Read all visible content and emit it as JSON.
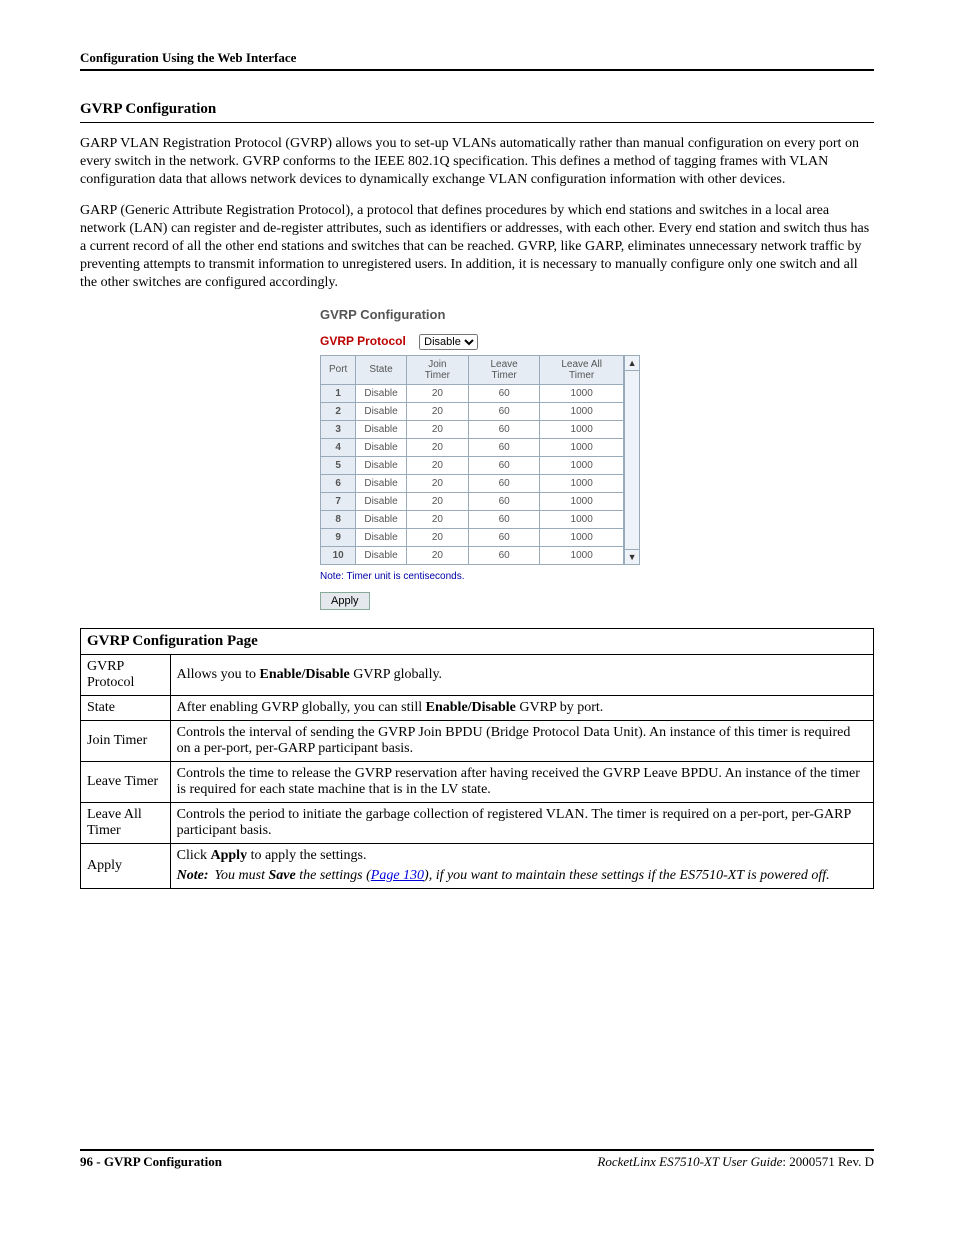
{
  "header": {
    "running": "Configuration Using the Web Interface"
  },
  "section": {
    "title": "GVRP Configuration"
  },
  "paragraphs": {
    "p1": "GARP VLAN Registration Protocol (GVRP) allows you to set-up VLANs automatically rather than manual configuration on every port on every switch in the network. GVRP conforms to the IEEE 802.1Q specification. This defines a method of tagging frames with VLAN configuration data that allows network devices to dynamically exchange VLAN configuration information with other devices.",
    "p2": "GARP (Generic Attribute Registration Protocol), a protocol that defines procedures by which end stations and switches in a local area network (LAN) can register and de-register attributes, such as identifiers or addresses, with each other. Every end station and switch thus has a current record of all the other end stations and switches that can be reached. GVRP, like GARP, eliminates unnecessary network traffic by preventing attempts to transmit information to unregistered users. In addition, it is necessary to manually configure only one switch and all the other switches are configured accordingly."
  },
  "embed": {
    "title": "GVRP Configuration",
    "protocol_label": "GVRP Protocol",
    "protocol_value": "Disable",
    "headers": [
      "Port",
      "State",
      "Join Timer",
      "Leave Timer",
      "Leave All Timer"
    ],
    "rows": [
      {
        "port": "1",
        "state": "Disable",
        "join": "20",
        "leave": "60",
        "lat": "1000"
      },
      {
        "port": "2",
        "state": "Disable",
        "join": "20",
        "leave": "60",
        "lat": "1000"
      },
      {
        "port": "3",
        "state": "Disable",
        "join": "20",
        "leave": "60",
        "lat": "1000"
      },
      {
        "port": "4",
        "state": "Disable",
        "join": "20",
        "leave": "60",
        "lat": "1000"
      },
      {
        "port": "5",
        "state": "Disable",
        "join": "20",
        "leave": "60",
        "lat": "1000"
      },
      {
        "port": "6",
        "state": "Disable",
        "join": "20",
        "leave": "60",
        "lat": "1000"
      },
      {
        "port": "7",
        "state": "Disable",
        "join": "20",
        "leave": "60",
        "lat": "1000"
      },
      {
        "port": "8",
        "state": "Disable",
        "join": "20",
        "leave": "60",
        "lat": "1000"
      },
      {
        "port": "9",
        "state": "Disable",
        "join": "20",
        "leave": "60",
        "lat": "1000"
      },
      {
        "port": "10",
        "state": "Disable",
        "join": "20",
        "leave": "60",
        "lat": "1000"
      }
    ],
    "note": "Note: Timer unit is centiseconds.",
    "apply": "Apply"
  },
  "desc": {
    "caption": "GVRP Configuration Page",
    "rows": [
      {
        "k": "GVRP Protocol",
        "v_pre": "Allows you to ",
        "v_bold": "Enable/Disable",
        "v_post": " GVRP globally."
      },
      {
        "k": "State",
        "v_pre": "After enabling GVRP globally, you can still ",
        "v_bold": "Enable/Disable",
        "v_post": " GVRP by port."
      },
      {
        "k": "Join Timer",
        "v": "Controls the interval of sending the GVRP Join BPDU (Bridge Protocol Data Unit). An instance of this timer is required on a per-port, per-GARP participant basis."
      },
      {
        "k": "Leave Timer",
        "v": "Controls the time to release the GVRP reservation after having received the GVRP Leave BPDU. An instance of the timer is required for each state machine that is in the LV state."
      },
      {
        "k": "Leave All Timer",
        "v": "Controls the period to initiate the garbage collection of registered VLAN. The timer is required on a per-port, per-GARP participant basis."
      }
    ],
    "apply": {
      "k": "Apply",
      "line1_pre": "Click ",
      "line1_bold": "Apply",
      "line1_post": " to apply the settings.",
      "note_label": "Note:",
      "note_pre": "You must ",
      "note_bold": "Save",
      "note_mid": " the settings (",
      "note_link": "Page 130",
      "note_post": "), if you want to maintain these settings if the ES7510-XT is powered off."
    }
  },
  "footer": {
    "left_num": "96 - ",
    "left_text": "GVRP Configuration",
    "right_ital": "RocketLinx ES7510-XT  User Guide",
    "right_rest": ": 2000571 Rev. D"
  }
}
